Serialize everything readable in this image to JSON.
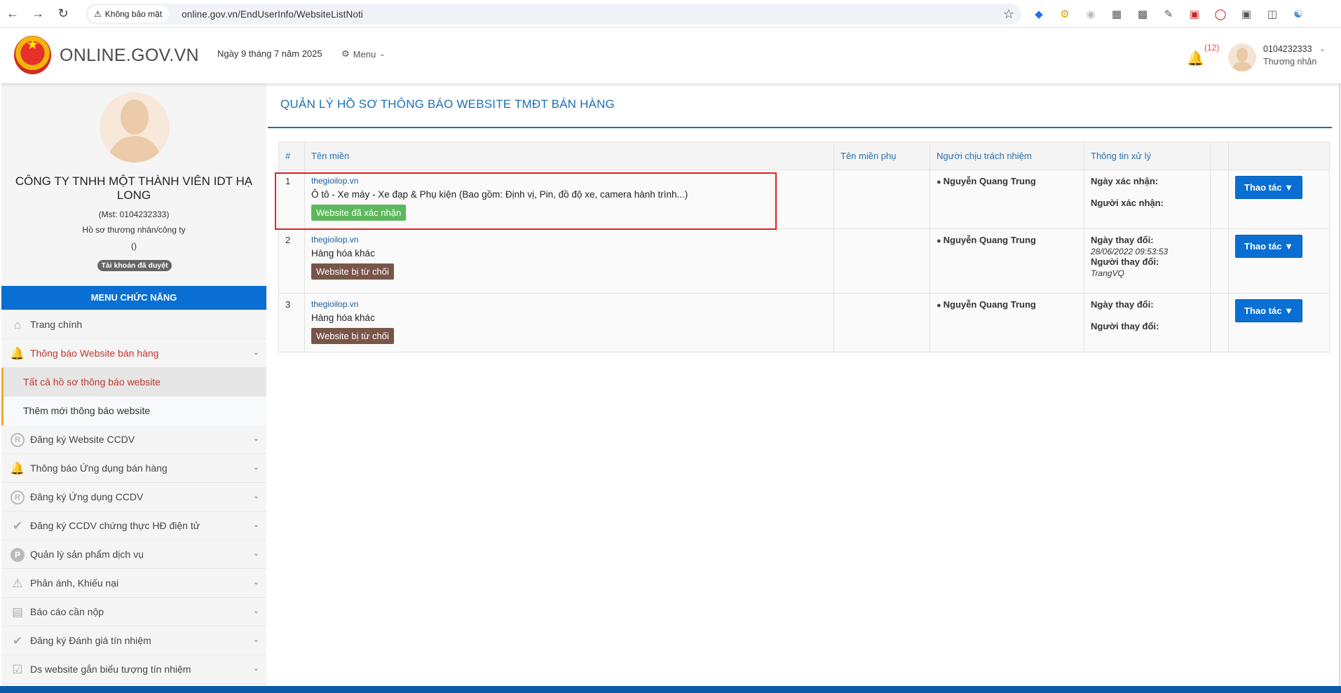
{
  "browser": {
    "security_label": "Không bảo mật",
    "url": "online.gov.vn/EndUserInfo/WebsiteListNoti"
  },
  "header": {
    "site_title": "ONLINE.GOV.VN",
    "date": "Ngày 9 tháng 7 năm 2025",
    "menu_label": "Menu",
    "notification_count": "(12)",
    "user_id": "0104232333",
    "user_role": "Thương nhân"
  },
  "profile": {
    "company_name": "CÔNG TY TNHH MỘT THÀNH VIÊN IDT HẠ LONG",
    "mst": "(Mst: 0104232333)",
    "profile_type": "Hồ sơ thương nhân/công ty",
    "paren": "()",
    "account_status": "Tài khoản đã duyệt"
  },
  "sidebar": {
    "menu_title": "MENU CHỨC NĂNG",
    "items": [
      {
        "label": "Trang chính"
      },
      {
        "label": "Thông báo Website bán hàng"
      },
      {
        "label": "Đăng ký Website CCDV"
      },
      {
        "label": "Thông báo Ứng dụng bán hàng"
      },
      {
        "label": "Đăng ký Ứng dụng CCDV"
      },
      {
        "label": "Đăng ký CCDV chứng thực HĐ điện tử"
      },
      {
        "label": "Quản lý sản phẩm dịch vụ"
      },
      {
        "label": "Phản ánh, Khiếu nại"
      },
      {
        "label": "Báo cáo cần nộp"
      },
      {
        "label": "Đăng ký Đánh giá tín nhiệm"
      },
      {
        "label": "Ds website gắn biểu tượng tín nhiệm"
      }
    ],
    "subitems": [
      {
        "label": "Tất cả hồ sơ thông báo website"
      },
      {
        "label": "Thêm mới thông báo website"
      }
    ]
  },
  "main": {
    "title": "QUẢN LÝ HỒ SƠ THÔNG BÁO WEBSITE TMĐT BÁN HÀNG",
    "columns": [
      "#",
      "Tên miền",
      "Tên miền phụ",
      "Người chịu trách nhiệm",
      "Thông tin xử lý"
    ],
    "rows": [
      {
        "index": "1",
        "domain": "thegioilop.vn",
        "goods": "Ô tô - Xe máy - Xe đạp & Phụ kiện (Bao gồm: Định vị, Pin, đồ độ xe, camera hành trình...)",
        "status": "Website đã xác nhận",
        "responsible": "Nguyễn Quang Trung",
        "info_label_1": "Ngày xác nhận:",
        "info_value_1": "",
        "info_label_2": "Người xác nhận:",
        "info_value_2": "",
        "action": "Thao tác"
      },
      {
        "index": "2",
        "domain": "thegioilop.vn",
        "goods": "Hàng hóa khác",
        "status": "Website bị từ chối",
        "responsible": "Nguyễn Quang Trung",
        "info_label_1": "Ngày thay đổi:",
        "info_value_1": "28/06/2022 09:53:53",
        "info_label_2": "Người thay đổi:",
        "info_value_2": "TrangVQ",
        "action": "Thao tác"
      },
      {
        "index": "3",
        "domain": "thegioilop.vn",
        "goods": "Hàng hóa khác",
        "status": "Website bị từ chối",
        "responsible": "Nguyễn Quang Trung",
        "info_label_1": "Ngày thay đổi:",
        "info_value_1": "",
        "info_label_2": "Người thay đổi:",
        "info_value_2": "",
        "action": "Thao tác"
      }
    ]
  },
  "icons": {
    "back": "arrow-left-icon",
    "forward": "arrow-right-icon",
    "reload": "reload-icon",
    "warning": "warning-icon",
    "star": "star-icon",
    "bell": "bell-icon",
    "gear": "gear-icon",
    "user": "user-icon"
  },
  "colors": {
    "primary": "#0a6fd3",
    "title": "#1a6fb5",
    "active_menu": "#c0392b",
    "badge_ok": "#5cb85c",
    "badge_rejected": "#795548",
    "highlight": "#e02020"
  }
}
